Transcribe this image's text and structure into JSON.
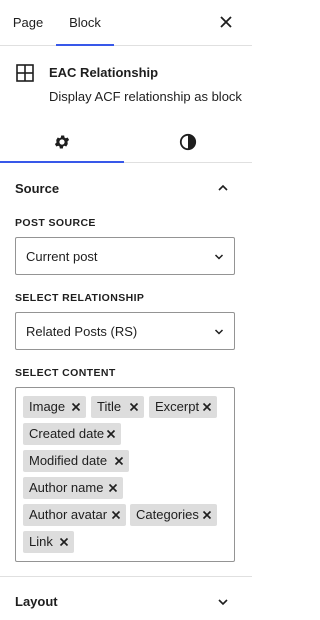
{
  "tabs": {
    "page": "Page",
    "block": "Block"
  },
  "block": {
    "title": "EAC Relationship",
    "description": "Display ACF relationship as block"
  },
  "source_panel": {
    "title": "Source",
    "post_source": {
      "label": "POST SOURCE",
      "value": "Current post"
    },
    "relationship": {
      "label": "SELECT RELATIONSHIP",
      "value": "Related Posts (RS)"
    },
    "content": {
      "label": "SELECT CONTENT",
      "tokens": [
        "Image",
        "Title",
        "Excerpt",
        "Created date",
        "Modified date",
        "Author name",
        "Author avatar",
        "Categories",
        "Link"
      ]
    }
  },
  "layout_panel": {
    "title": "Layout"
  },
  "colors": {
    "accent": "#3858e9",
    "token_bg": "#dddddd",
    "border": "#949494",
    "divider": "#e0e0e0"
  }
}
